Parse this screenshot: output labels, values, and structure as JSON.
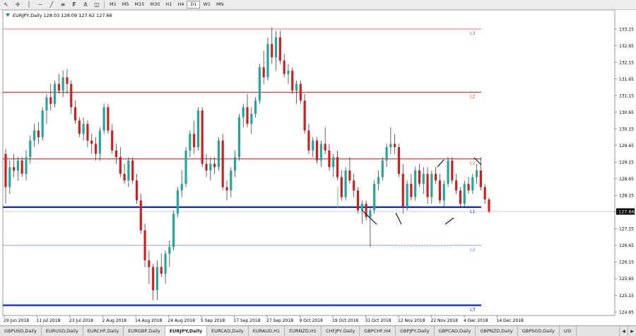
{
  "toolbar": {
    "tools": [
      {
        "icon": "cursor-arrow-icon",
        "glyph": "↖"
      },
      {
        "icon": "crosshair-icon",
        "glyph": "✛"
      },
      {
        "icon": "vertical-line-icon",
        "glyph": "│"
      },
      {
        "icon": "horizontal-line-icon",
        "glyph": "─"
      },
      {
        "icon": "trendline-icon",
        "glyph": "╱"
      },
      {
        "icon": "channel-icon",
        "glyph": "≡"
      },
      {
        "icon": "fibonacci-icon",
        "glyph": "𝐅"
      },
      {
        "icon": "text-label-icon",
        "glyph": "A"
      },
      {
        "icon": "shapes-icon",
        "glyph": "◫"
      }
    ],
    "timeframes": [
      "M1",
      "M5",
      "M15",
      "M30",
      "H1",
      "H4",
      "D1",
      "W1",
      "MN"
    ],
    "active_timeframe": "D1"
  },
  "chart": {
    "symbol_header": "EURJPY,Daily  128.03 128.09 127.62 127.66",
    "current_price": "127.66",
    "colors": {
      "bull": "#20a89c",
      "bear": "#d01e1e",
      "resistance": "#d84848",
      "support": "#1830c8",
      "thin_support": "#7080d8"
    },
    "y_axis_ticks": [
      "133.15",
      "132.65",
      "132.15",
      "131.65",
      "131.15",
      "130.65",
      "130.15",
      "129.65",
      "129.15",
      "128.65",
      "128.15",
      "127.65",
      "127.15",
      "126.65",
      "126.15",
      "125.65",
      "125.15",
      "124.65"
    ],
    "x_axis_labels": [
      "29 Jun 2018",
      "11 Jul 2018",
      "23 Jul 2018",
      "2 Aug 2018",
      "14 Aug 2018",
      "24 Aug 2018",
      "5 Sep 2018",
      "17 Sep 2018",
      "27 Sep 2018",
      "9 Oct 2018",
      "19 Oct 2018",
      "31 Oct 2018",
      "12 Nov 2018",
      "22 Nov 2018",
      "4 Dec 2018",
      "14 Dec 2018"
    ],
    "levels": [
      {
        "label": "L3",
        "price": 133.15,
        "kind": "resistance-thin"
      },
      {
        "label": "L2",
        "price": 131.25,
        "kind": "resistance"
      },
      {
        "label": "L1",
        "price": 129.25,
        "kind": "resistance"
      },
      {
        "label": "L1",
        "price": 127.8,
        "kind": "support"
      },
      {
        "label": "L2",
        "price": 126.65,
        "kind": "support-thin"
      },
      {
        "label": "L3",
        "price": 124.85,
        "kind": "support"
      }
    ],
    "candles": [
      [
        129.4,
        129.55,
        127.9,
        128.4
      ],
      [
        128.4,
        129.2,
        128.2,
        129.0
      ],
      [
        129.0,
        129.4,
        128.7,
        128.9
      ],
      [
        128.9,
        129.3,
        128.6,
        129.2
      ],
      [
        129.2,
        129.3,
        128.7,
        128.8
      ],
      [
        128.8,
        129.5,
        128.6,
        129.3
      ],
      [
        129.3,
        129.95,
        129.1,
        129.8
      ],
      [
        129.8,
        130.3,
        129.6,
        130.1
      ],
      [
        130.1,
        130.35,
        129.7,
        129.9
      ],
      [
        129.9,
        130.8,
        129.8,
        130.7
      ],
      [
        130.7,
        131.2,
        130.3,
        131.1
      ],
      [
        131.1,
        131.5,
        130.7,
        130.9
      ],
      [
        130.9,
        131.6,
        130.8,
        131.5
      ],
      [
        131.5,
        131.8,
        131.2,
        131.3
      ],
      [
        131.3,
        131.9,
        131.1,
        131.7
      ],
      [
        131.7,
        131.95,
        131.2,
        131.5
      ],
      [
        131.5,
        131.6,
        130.6,
        130.8
      ],
      [
        130.8,
        131.0,
        130.3,
        130.4
      ],
      [
        130.4,
        130.5,
        129.9,
        130.0
      ],
      [
        130.0,
        130.5,
        129.8,
        130.3
      ],
      [
        130.3,
        130.4,
        129.6,
        129.8
      ],
      [
        129.8,
        130.0,
        129.4,
        129.7
      ],
      [
        129.7,
        129.9,
        129.2,
        129.4
      ],
      [
        129.4,
        130.2,
        129.2,
        130.1
      ],
      [
        130.1,
        130.9,
        130.0,
        130.8
      ],
      [
        130.8,
        130.9,
        130.0,
        130.1
      ],
      [
        130.1,
        130.3,
        129.4,
        129.5
      ],
      [
        129.5,
        129.7,
        129.1,
        129.3
      ],
      [
        129.3,
        129.6,
        128.7,
        128.8
      ],
      [
        128.8,
        129.1,
        128.5,
        128.6
      ],
      [
        128.6,
        129.3,
        128.4,
        129.2
      ],
      [
        129.2,
        129.3,
        128.5,
        128.6
      ],
      [
        128.6,
        128.8,
        127.9,
        128.0
      ],
      [
        128.0,
        128.2,
        127.0,
        127.1
      ],
      [
        127.1,
        127.3,
        126.0,
        126.2
      ],
      [
        126.2,
        126.5,
        125.5,
        126.0
      ],
      [
        126.0,
        126.1,
        125.0,
        125.3
      ],
      [
        125.3,
        126.2,
        125.0,
        126.0
      ],
      [
        126.0,
        126.4,
        125.7,
        125.8
      ],
      [
        125.8,
        126.5,
        125.5,
        126.4
      ],
      [
        126.4,
        126.8,
        126.0,
        126.6
      ],
      [
        126.6,
        127.7,
        126.5,
        127.6
      ],
      [
        127.6,
        128.4,
        127.5,
        128.3
      ],
      [
        128.3,
        128.9,
        128.1,
        128.5
      ],
      [
        128.5,
        129.6,
        128.4,
        129.5
      ],
      [
        129.5,
        130.1,
        129.3,
        130.0
      ],
      [
        130.0,
        130.4,
        129.4,
        129.6
      ],
      [
        129.6,
        130.8,
        129.5,
        130.7
      ],
      [
        130.7,
        130.8,
        129.0,
        129.1
      ],
      [
        129.1,
        129.4,
        128.7,
        128.9
      ],
      [
        128.9,
        129.3,
        128.6,
        129.1
      ],
      [
        129.1,
        129.3,
        128.8,
        129.0
      ],
      [
        129.0,
        129.9,
        128.9,
        129.8
      ],
      [
        129.8,
        130.0,
        128.3,
        128.4
      ],
      [
        128.4,
        128.6,
        128.0,
        128.3
      ],
      [
        128.3,
        129.0,
        128.1,
        128.9
      ],
      [
        128.9,
        129.5,
        128.7,
        129.3
      ],
      [
        129.3,
        130.6,
        129.2,
        130.5
      ],
      [
        130.5,
        130.9,
        130.2,
        130.8
      ],
      [
        130.8,
        131.2,
        130.2,
        130.3
      ],
      [
        130.3,
        130.8,
        130.0,
        130.6
      ],
      [
        130.6,
        131.1,
        130.5,
        131.0
      ],
      [
        131.0,
        132.1,
        130.9,
        132.0
      ],
      [
        132.0,
        132.5,
        131.5,
        131.7
      ],
      [
        131.7,
        132.9,
        131.6,
        132.7
      ],
      [
        132.7,
        133.2,
        132.1,
        132.3
      ],
      [
        132.3,
        133.1,
        131.9,
        132.9
      ],
      [
        132.9,
        133.1,
        132.1,
        132.2
      ],
      [
        132.2,
        132.4,
        131.7,
        131.8
      ],
      [
        131.8,
        132.1,
        131.5,
        131.9
      ],
      [
        131.9,
        132.0,
        131.2,
        131.3
      ],
      [
        131.3,
        131.6,
        130.9,
        131.5
      ],
      [
        131.5,
        131.6,
        130.9,
        131.0
      ],
      [
        131.0,
        131.2,
        130.0,
        130.1
      ],
      [
        130.1,
        130.3,
        129.4,
        129.5
      ],
      [
        129.5,
        129.9,
        129.3,
        129.8
      ],
      [
        129.8,
        129.9,
        129.1,
        129.2
      ],
      [
        129.2,
        129.8,
        129.0,
        129.7
      ],
      [
        129.7,
        130.2,
        129.4,
        129.5
      ],
      [
        129.5,
        129.7,
        128.9,
        129.0
      ],
      [
        129.0,
        129.4,
        128.7,
        129.3
      ],
      [
        129.3,
        129.5,
        128.6,
        128.7
      ],
      [
        128.7,
        128.9,
        128.0,
        128.1
      ],
      [
        128.1,
        129.0,
        128.0,
        128.9
      ],
      [
        128.9,
        129.3,
        128.5,
        128.6
      ],
      [
        128.6,
        128.8,
        128.1,
        128.3
      ],
      [
        128.3,
        128.4,
        127.6,
        127.7
      ],
      [
        127.7,
        128.0,
        127.3,
        127.9
      ],
      [
        127.9,
        128.0,
        127.4,
        127.5
      ],
      [
        127.5,
        127.8,
        126.6,
        127.7
      ],
      [
        127.7,
        128.6,
        127.6,
        128.5
      ],
      [
        128.5,
        128.9,
        128.3,
        128.7
      ],
      [
        128.7,
        129.3,
        128.6,
        129.2
      ],
      [
        129.2,
        129.7,
        129.0,
        129.6
      ],
      [
        129.6,
        130.2,
        129.4,
        129.7
      ],
      [
        129.7,
        130.0,
        129.4,
        129.6
      ],
      [
        129.6,
        129.7,
        128.7,
        128.8
      ],
      [
        128.8,
        129.1,
        127.6,
        127.8
      ],
      [
        127.8,
        128.6,
        127.7,
        128.5
      ],
      [
        128.5,
        128.8,
        128.0,
        128.1
      ],
      [
        128.1,
        129.0,
        128.0,
        128.9
      ],
      [
        128.9,
        129.1,
        128.4,
        128.5
      ],
      [
        128.5,
        129.0,
        128.2,
        128.8
      ],
      [
        128.8,
        129.0,
        127.9,
        128.1
      ],
      [
        128.1,
        128.9,
        127.9,
        128.8
      ],
      [
        128.8,
        129.0,
        128.5,
        128.6
      ],
      [
        128.6,
        128.8,
        127.9,
        128.0
      ],
      [
        128.0,
        128.6,
        127.8,
        128.5
      ],
      [
        128.5,
        129.3,
        128.4,
        129.2
      ],
      [
        129.2,
        129.3,
        128.5,
        128.6
      ],
      [
        128.6,
        128.8,
        128.2,
        128.3
      ],
      [
        128.3,
        128.4,
        127.8,
        127.9
      ],
      [
        127.9,
        128.6,
        127.8,
        128.5
      ],
      [
        128.5,
        128.7,
        128.2,
        128.3
      ],
      [
        128.3,
        128.8,
        128.2,
        128.7
      ],
      [
        128.7,
        129.1,
        128.5,
        128.9
      ],
      [
        128.9,
        129.3,
        128.3,
        128.4
      ],
      [
        128.4,
        128.5,
        127.9,
        128.03
      ],
      [
        128.03,
        128.09,
        127.62,
        127.66
      ]
    ]
  },
  "tabs": [
    "GBPUSD,Daily",
    "EURUSD,Daily",
    "EURCHF,Daily",
    "EURGBP,Daily",
    "EURJPY,Daily",
    "EURCAD,Daily",
    "EURAUD,H1",
    "EURNZD,H1",
    "CHFJPY,Daily",
    "GBPCHF,H4",
    "GBPJPY,Daily",
    "GBPCAD,Daily",
    "GBPNZD,Daily",
    "GBPSGD,Daily",
    "USI"
  ],
  "active_tab": "EURJPY,Daily"
}
